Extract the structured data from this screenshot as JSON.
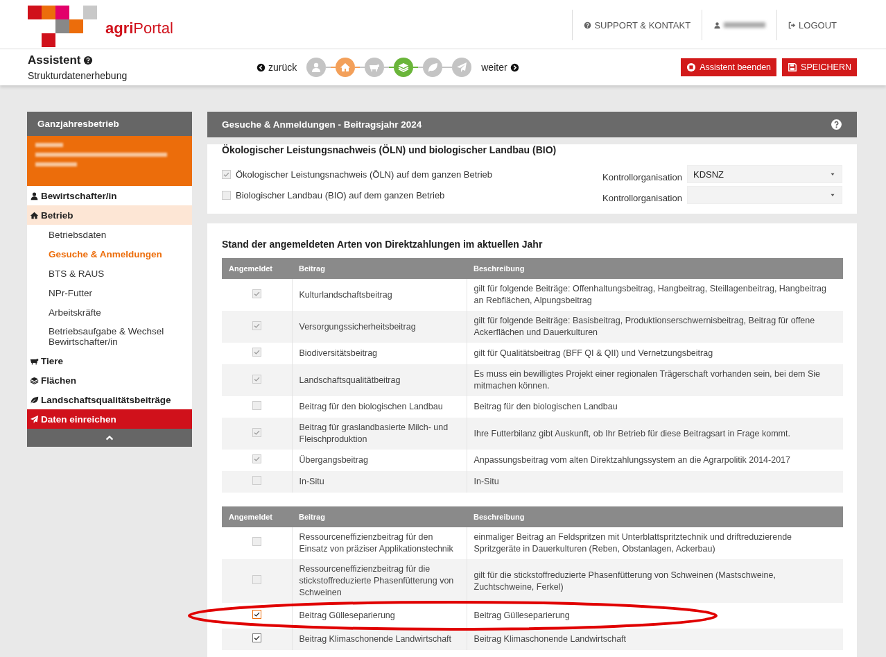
{
  "header": {
    "logo_text_bold": "agri",
    "logo_text": "Portal",
    "links": [
      {
        "kind": "support",
        "label": "SUPPORT & KONTAKT"
      },
      {
        "kind": "user"
      },
      {
        "kind": "logout",
        "label": "LOGOUT"
      }
    ]
  },
  "assistant": {
    "title": "Assistent",
    "subtitle": "Strukturdatenerhebung",
    "back": "zurück",
    "next": "weiter",
    "steps": [
      {
        "visited": false,
        "selected": false
      },
      {
        "visited": true,
        "selected": false
      },
      {
        "visited": false,
        "selected": false
      },
      {
        "visited": false,
        "selected": true
      },
      {
        "visited": false,
        "selected": false
      },
      {
        "visited": false,
        "selected": false
      }
    ],
    "buttons": [
      {
        "kind": "stop",
        "label": "Assistent beenden"
      },
      {
        "kind": "save",
        "label": "SPEICHERN"
      }
    ]
  },
  "sidebar": {
    "title": "Ganzjahresbetrieb",
    "items": [
      {
        "kind": "section",
        "label": "Bewirtschafter/in",
        "selected": false
      },
      {
        "kind": "section",
        "label": "Betrieb",
        "selected": true
      },
      {
        "kind": "subitem",
        "label": "Betriebsdaten",
        "selected": false
      },
      {
        "kind": "subitem",
        "label": "Gesuche & Anmeldungen",
        "selected": true
      },
      {
        "kind": "subitem",
        "label": "BTS & RAUS",
        "selected": false
      },
      {
        "kind": "subitem",
        "label": "NPr-Futter",
        "selected": false
      },
      {
        "kind": "subitem",
        "label": "Arbeitskräfte",
        "selected": false
      },
      {
        "kind": "subitem",
        "label": "Betriebsaufgabe & Wechsel Bewirtschafter/in",
        "selected": false
      },
      {
        "kind": "section",
        "label": "Tiere",
        "selected": false
      },
      {
        "kind": "section",
        "label": "Flächen",
        "selected": false
      },
      {
        "kind": "section",
        "label": "Landschaftsqualitätsbeiträge",
        "selected": false
      },
      {
        "kind": "action",
        "label": "Daten einreichen",
        "selected": false
      }
    ]
  },
  "panel": {
    "title": "Gesuche & Anmeldungen - Beitragsjahr 2024",
    "oeln": {
      "heading": "Ökologischer Leistungsnachweis (ÖLN) und biologischer Landbau (BIO)",
      "rows": [
        {
          "label": "Ökologischer Leistungsnachweis (ÖLN) auf dem ganzen Betrieb",
          "checked": true,
          "field_label": "Kontrollorganisation",
          "value": "KDSNZ"
        },
        {
          "label": "Biologischer Landbau (BIO) auf dem ganzen Betrieb",
          "checked": false,
          "field_label": "Kontrollorganisation",
          "value": ""
        }
      ]
    },
    "status": {
      "heading": "Stand der angemeldeten Arten von Direktzahlungen im aktuellen Jahr",
      "tables": [
        {
          "columns": [
            "Angemeldet",
            "Beitrag",
            "Beschreibung"
          ],
          "rows": [
            {
              "checked": true,
              "disabled": true,
              "focused": false,
              "beitrag": "Kulturlandschaftsbeitrag",
              "beschreibung": "gilt für folgende Beiträge: Offenhaltungsbeitrag, Hangbeitrag, Steillagenbeitrag, Hangbeitrag an Rebflächen, Alpungsbeitrag"
            },
            {
              "checked": true,
              "disabled": true,
              "focused": false,
              "beitrag": "Versorgungssicherheitsbeitrag",
              "beschreibung": "gilt für folgende Beiträge: Basisbeitrag, Produktionserschwernisbeitrag, Beitrag für offene Ackerflächen und Dauerkulturen"
            },
            {
              "checked": true,
              "disabled": true,
              "focused": false,
              "beitrag": "Biodiversitätsbeitrag",
              "beschreibung": "gilt für Qualitätsbeitrag (BFF QI & QII) und Vernetzungsbeitrag"
            },
            {
              "checked": true,
              "disabled": true,
              "focused": false,
              "beitrag": "Landschaftsqualitätbeitrag",
              "beschreibung": "Es muss ein bewilligtes Projekt einer regionalen Trägerschaft vorhanden sein, bei dem Sie mitmachen können."
            },
            {
              "checked": false,
              "disabled": true,
              "focused": false,
              "beitrag": "Beitrag für den biologischen Landbau",
              "beschreibung": "Beitrag für den biologischen Landbau"
            },
            {
              "checked": true,
              "disabled": true,
              "focused": false,
              "beitrag": "Beitrag für graslandbasierte Milch- und Fleischproduktion",
              "beschreibung": "Ihre Futterbilanz gibt Auskunft, ob Ihr Betrieb für diese Beitragsart in Frage kommt."
            },
            {
              "checked": true,
              "disabled": true,
              "focused": false,
              "beitrag": "Übergangsbeitrag",
              "beschreibung": "Anpassungsbeitrag vom alten Direktzahlungssystem an die Agrarpolitik 2014-2017"
            },
            {
              "checked": false,
              "disabled": true,
              "focused": false,
              "beitrag": "In-Situ",
              "beschreibung": "In-Situ"
            }
          ]
        },
        {
          "columns": [
            "Angemeldet",
            "Beitrag",
            "Beschreibung"
          ],
          "rows": [
            {
              "checked": false,
              "disabled": true,
              "focused": false,
              "beitrag": "Ressourceneffizienzbeitrag für den Einsatz von präziser Applikationstechnik",
              "beschreibung": "einmaliger Beitrag an Feldspritzen mit Unterblattspritztechnik und driftreduzierende Spritzgeräte in Dauerkulturen (Reben, Obstanlagen, Ackerbau)"
            },
            {
              "checked": false,
              "disabled": true,
              "focused": false,
              "beitrag": "Ressourceneffizienzbeitrag für die stickstoffreduzierte Phasenfütterung von Schweinen",
              "beschreibung": "gilt für die stickstoffreduzierte Phasenfütterung von Schweinen (Mastschweine, Zuchtschweine, Ferkel)"
            },
            {
              "checked": true,
              "disabled": false,
              "focused": true,
              "beitrag": "Beitrag Gülleseparierung",
              "beschreibung": "Beitrag Gülleseparierung"
            },
            {
              "checked": true,
              "disabled": false,
              "focused": false,
              "beitrag": "Beitrag Klimaschonende Landwirtschaft",
              "beschreibung": "Beitrag Klimaschonende Landwirtschaft"
            }
          ]
        }
      ]
    }
  },
  "annotation": {
    "kind": "ellipse"
  }
}
